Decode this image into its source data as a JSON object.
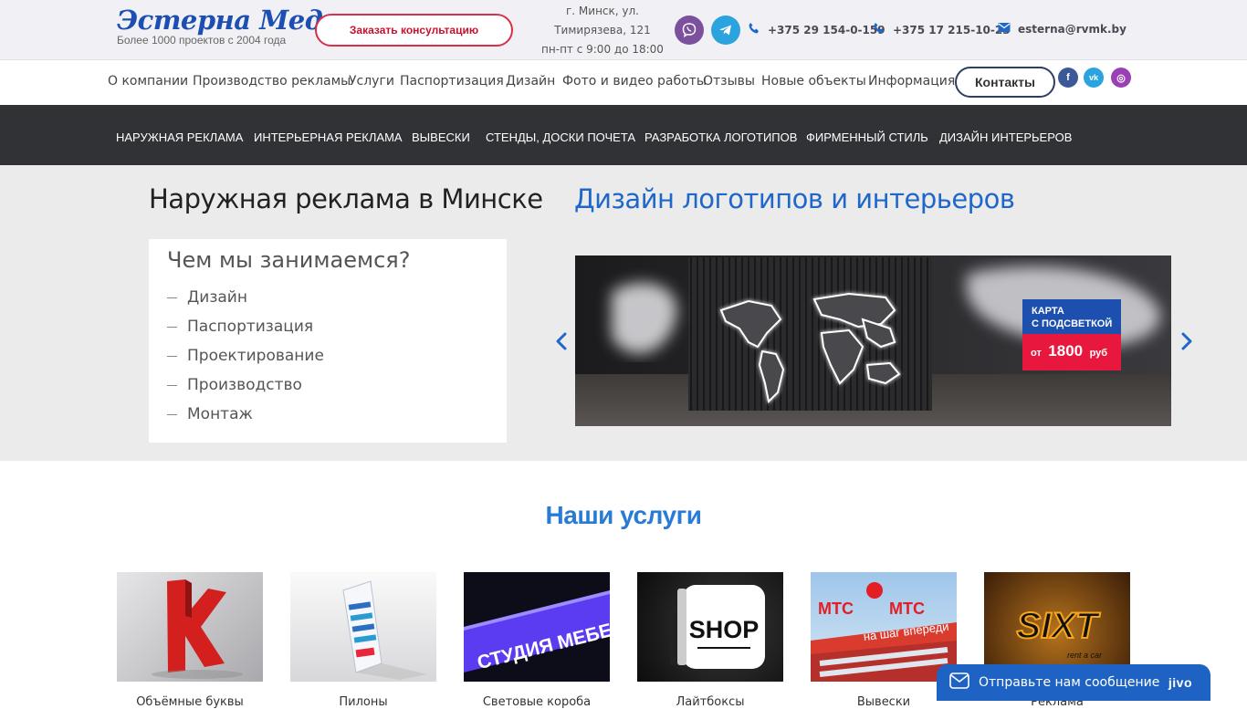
{
  "header": {
    "logo_title": "Эстерна Медиа",
    "logo_subtitle": "Более 1000 проектов с 2004 года",
    "consult_button": "Заказать консультацию",
    "address_line1": "г. Минск, ул.",
    "address_line2": "Тимирязева, 121",
    "hours": "пн-пт с 9:00 до 18:00",
    "phone1": "+375 29 154-0-159",
    "phone2": "+375 17 215-10-23",
    "email": "esterna@rvmk.by",
    "icons": [
      "viber-icon",
      "telegram-icon",
      "phone-icon",
      "email-icon"
    ]
  },
  "nav": {
    "items": [
      "О компании",
      "Производство рекламы",
      "Услуги",
      "Паспортизация",
      "Дизайн",
      "Фото и видео работы",
      "Отзывы",
      "Новые объекты",
      "Информация"
    ],
    "contacts_button": "Контакты",
    "social": [
      "facebook-icon",
      "vk-icon",
      "instagram-icon"
    ],
    "social_letters": [
      "f",
      "vk",
      "◎"
    ],
    "social_colors": [
      "#3b5998",
      "#4a76a8",
      "#8a3ab9"
    ]
  },
  "menu": {
    "items": [
      "НАРУЖНАЯ РЕКЛАМА",
      "ИНТЕРЬЕРНАЯ РЕКЛАМА",
      "ВЫВЕСКИ",
      "СТЕНДЫ, ДОСКИ ПОЧЕТА",
      "РАЗРАБОТКА ЛОГОТИПОВ",
      "ФИРМЕННЫЙ СТИЛЬ",
      "ДИЗАЙН ИНТЕРЬЕРОВ"
    ]
  },
  "hero": {
    "title": "Наружная реклама в Минске",
    "subtitle": "Дизайн логотипов и интерьеров",
    "card_title": "Чем мы занимаемся?",
    "card_items": [
      "Дизайн",
      "Паспортизация",
      "Проектирование",
      "Производство",
      "Монтаж"
    ],
    "slide_badge_line1": "КАРТА",
    "slide_badge_line2": "С ПОДСВЕТКОЙ",
    "slide_price_prefix": "от",
    "slide_price": "1800",
    "slide_price_suffix": "руб"
  },
  "services": {
    "title": "Наши услуги",
    "thumb_texts": [
      "К",
      "",
      "СТУДИЯ МЕБЕЛИ",
      "SHOP",
      "МТС",
      "SIXT"
    ],
    "thumb_subtexts": [
      "",
      "",
      "",
      "",
      "на шаг впереди",
      "rent a car"
    ],
    "labels": [
      "Объёмные буквы",
      "Пилоны",
      "Световые короба",
      "Лайтбоксы",
      "Вывески",
      "Реклама"
    ]
  },
  "chat": {
    "text": "Отправьте нам сообщение",
    "brand": "jivo"
  },
  "colors": {
    "accent_blue": "#1f67c8",
    "consult_red": "#c8102e",
    "dark_menu": "#303236"
  }
}
